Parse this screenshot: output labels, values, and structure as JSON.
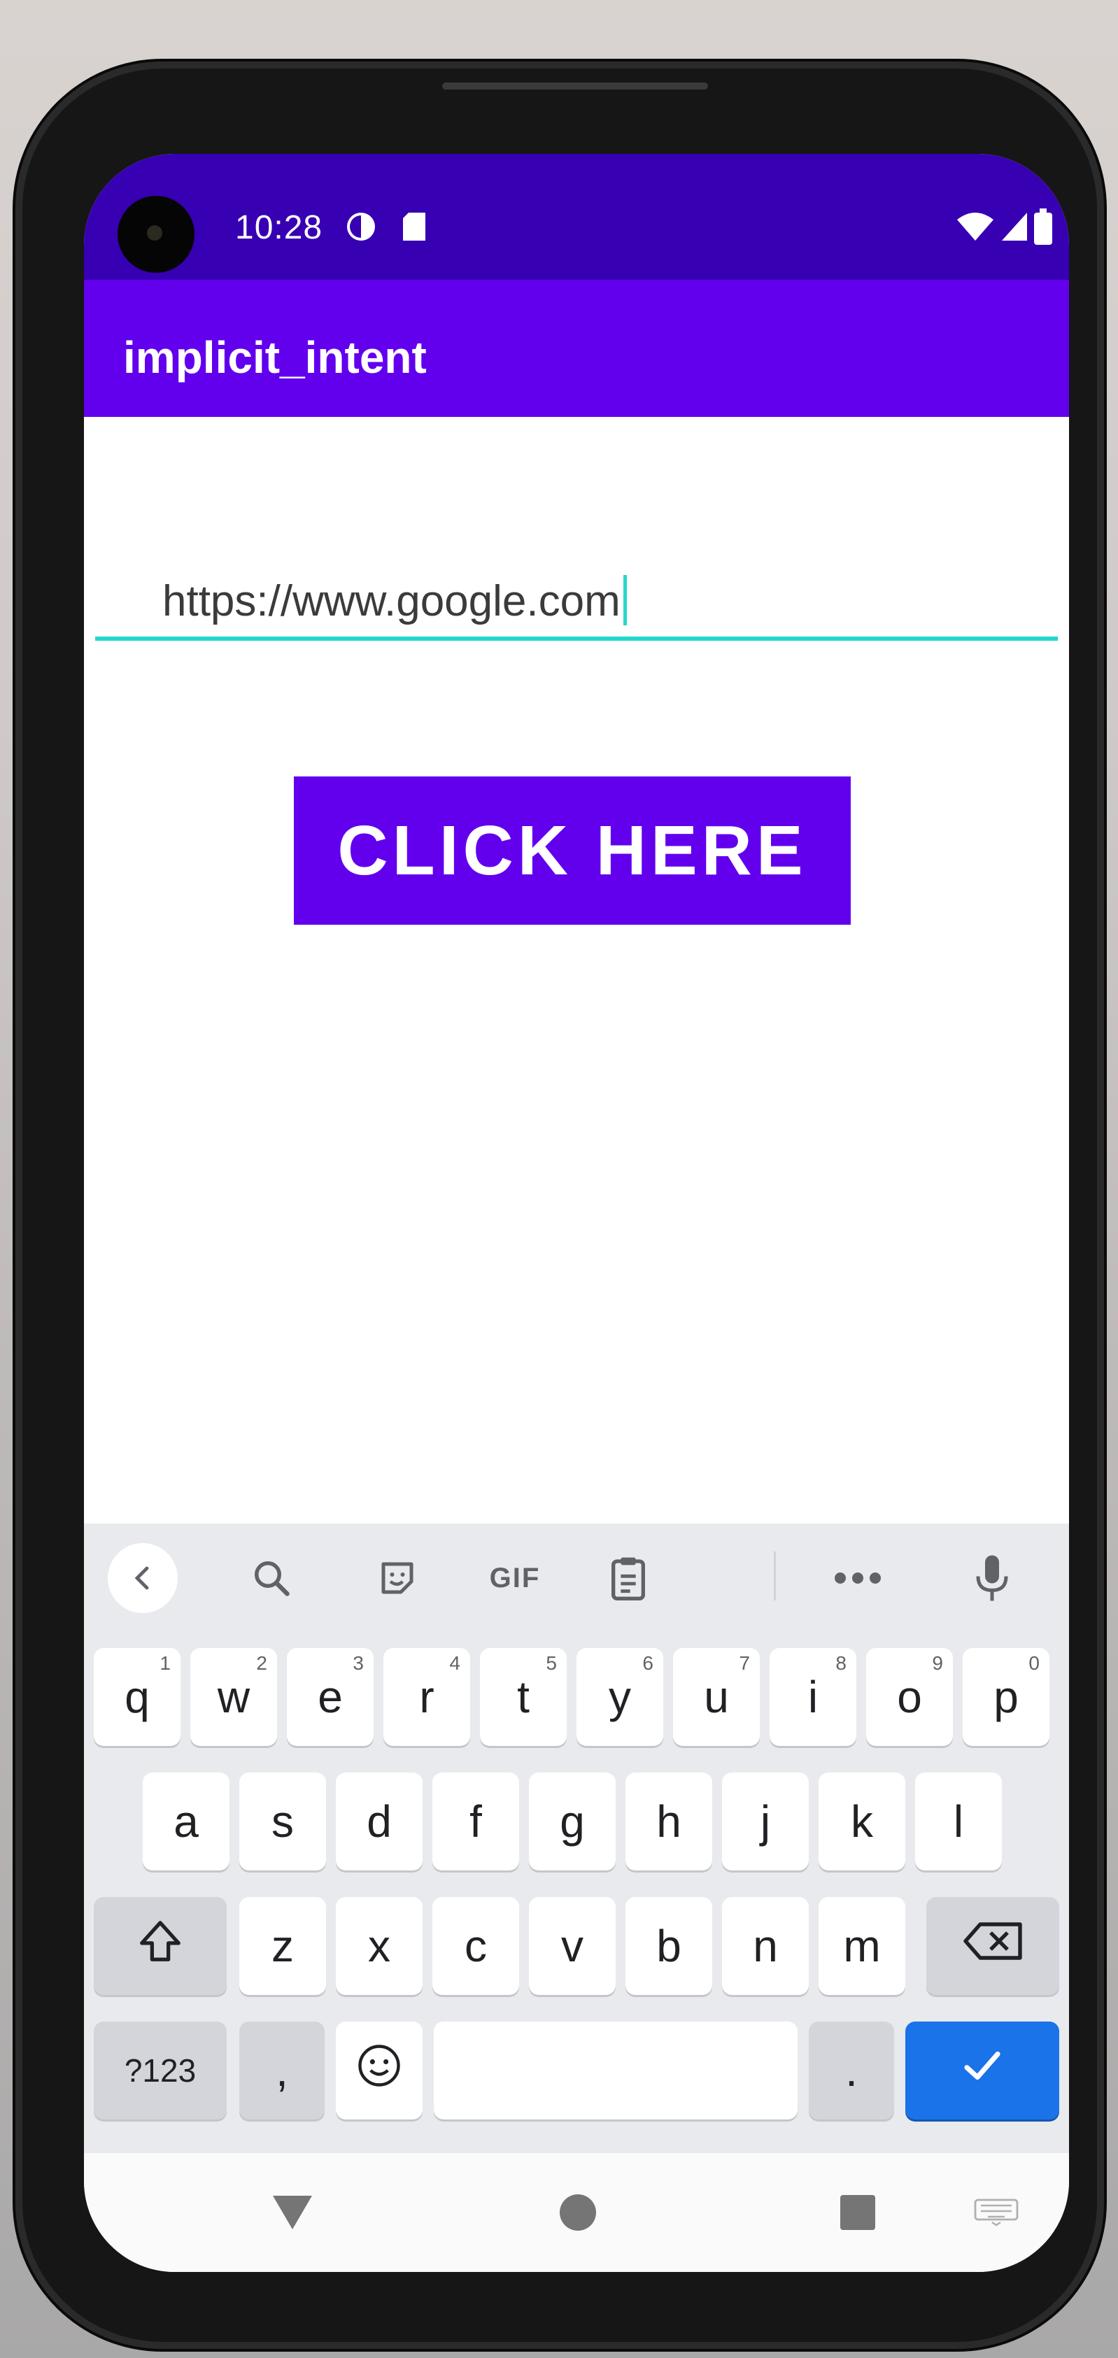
{
  "status_bar": {
    "time": "10:28",
    "icons": [
      "circle-half-icon",
      "sd-card-icon",
      "wifi-icon",
      "signal-icon",
      "battery-icon"
    ]
  },
  "app_bar": {
    "title": "implicit_intent"
  },
  "url_input": {
    "value": "https://www.google.com"
  },
  "main_button": {
    "label": "CLICK HERE"
  },
  "keyboard": {
    "toolbar": {
      "back_icon": "chevron-left-icon",
      "search_icon": "search-icon",
      "sticker_icon": "sticker-icon",
      "gif_label": "GIF",
      "clipboard_icon": "clipboard-icon",
      "more_icon": "more-horizontal-icon",
      "mic_icon": "mic-icon"
    },
    "row1": [
      "q",
      "w",
      "e",
      "r",
      "t",
      "y",
      "u",
      "i",
      "o",
      "p"
    ],
    "row1_hints": [
      "1",
      "2",
      "3",
      "4",
      "5",
      "6",
      "7",
      "8",
      "9",
      "0"
    ],
    "row2": [
      "a",
      "s",
      "d",
      "f",
      "g",
      "h",
      "j",
      "k",
      "l"
    ],
    "row3": [
      "z",
      "x",
      "c",
      "v",
      "b",
      "n",
      "m"
    ],
    "symbols_label": "?123",
    "comma_label": ",",
    "period_label": ".",
    "shift_icon": "shift-icon",
    "backspace_icon": "backspace-icon",
    "emoji_icon": "emoji-icon",
    "enter_icon": "checkmark-icon"
  },
  "nav_bar": {
    "back_icon": "triangle-back-icon",
    "home_icon": "circle-home-icon",
    "recents_icon": "square-recents-icon",
    "keyboard_icon": "keyboard-hide-icon"
  },
  "colors": {
    "status_bar": "#3700b3",
    "primary": "#6200ee",
    "accent": "#26d7cf",
    "enter_key": "#1a73e8"
  }
}
